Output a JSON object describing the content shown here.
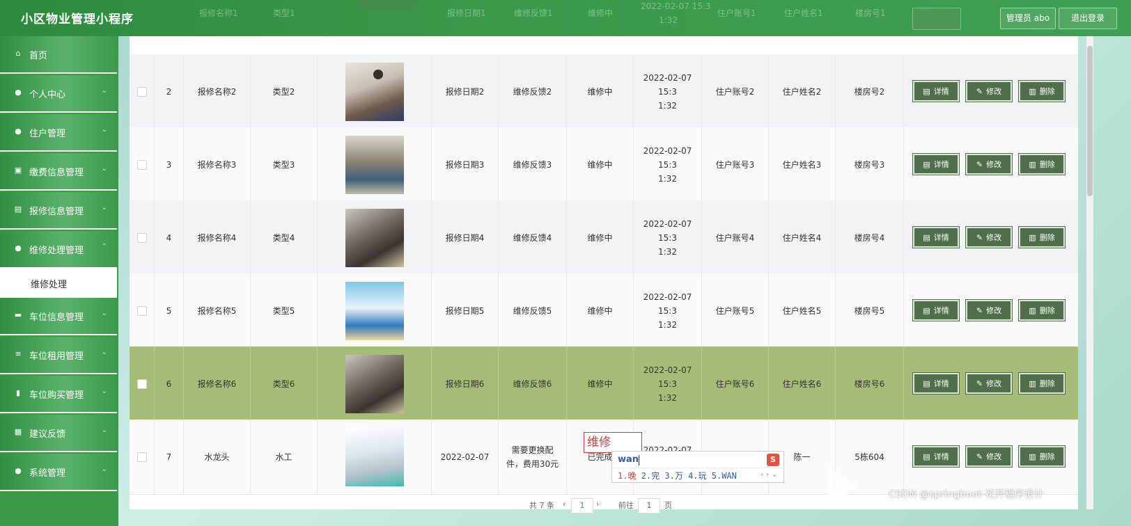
{
  "app": {
    "title": "小区物业管理小程序"
  },
  "header": {
    "admin_label": "管理员 abo",
    "logout_label": "退出登录"
  },
  "sidebar": {
    "items": [
      {
        "label": "首页",
        "icon": "home-icon",
        "glyph": "⌂"
      },
      {
        "label": "个人中心",
        "icon": "user-icon",
        "glyph": "●"
      },
      {
        "label": "住户管理",
        "icon": "location-pin-icon",
        "glyph": "●"
      },
      {
        "label": "缴费信息管理",
        "icon": "clipboard-icon",
        "glyph": "▣"
      },
      {
        "label": "报修信息管理",
        "icon": "document-icon",
        "glyph": "▤"
      },
      {
        "label": "维修处理管理",
        "icon": "user-icon",
        "glyph": "●"
      },
      {
        "label": "车位信息管理",
        "icon": "monitor-icon",
        "glyph": "▬"
      },
      {
        "label": "车位租用管理",
        "icon": "sliders-icon",
        "glyph": "≡"
      },
      {
        "label": "车位购买管理",
        "icon": "bar-chart-icon",
        "glyph": "▮"
      },
      {
        "label": "建议反馈",
        "icon": "grid-icon",
        "glyph": "▦"
      },
      {
        "label": "系统管理",
        "icon": "person-icon",
        "glyph": "●"
      }
    ],
    "sub_item": {
      "label": "维修处理"
    }
  },
  "top_faded_row": {
    "cols": [
      "报修名称1",
      "类型1",
      "报修日期1",
      "维修反馈1",
      "维修中",
      "2022-02-07 15:3",
      "1:32",
      "住户账号1",
      "住户姓名1",
      "楼房号1"
    ],
    "detail": "详情"
  },
  "buttons": {
    "detail": "详情",
    "edit": "修改",
    "delete": "删除"
  },
  "rows": [
    {
      "idx": "2",
      "name": "报修名称2",
      "type": "类型2",
      "date": "报修日期2",
      "feedback": "维修反馈2",
      "status": "维修中",
      "time1": "2022-02-07 15:3",
      "time2": "1:32",
      "account": "住户账号2",
      "owner": "住户姓名2",
      "room": "楼房号2"
    },
    {
      "idx": "3",
      "name": "报修名称3",
      "type": "类型3",
      "date": "报修日期3",
      "feedback": "维修反馈3",
      "status": "维修中",
      "time1": "2022-02-07 15:3",
      "time2": "1:32",
      "account": "住户账号3",
      "owner": "住户姓名3",
      "room": "楼房号3"
    },
    {
      "idx": "4",
      "name": "报修名称4",
      "type": "类型4",
      "date": "报修日期4",
      "feedback": "维修反馈4",
      "status": "维修中",
      "time1": "2022-02-07 15:3",
      "time2": "1:32",
      "account": "住户账号4",
      "owner": "住户姓名4",
      "room": "楼房号4"
    },
    {
      "idx": "5",
      "name": "报修名称5",
      "type": "类型5",
      "date": "报修日期5",
      "feedback": "维修反馈5",
      "status": "维修中",
      "time1": "2022-02-07 15:3",
      "time2": "1:32",
      "account": "住户账号5",
      "owner": "住户姓名5",
      "room": "楼房号5"
    },
    {
      "idx": "6",
      "name": "报修名称6",
      "type": "类型6",
      "date": "报修日期6",
      "feedback": "维修反馈6",
      "status": "维修中",
      "time1": "2022-02-07 15:3",
      "time2": "1:32",
      "account": "住户账号6",
      "owner": "住户姓名6",
      "room": "楼房号6"
    },
    {
      "idx": "7",
      "name": "水龙头",
      "type": "水工",
      "date": "2022-02-07",
      "feedback": "需要更换配",
      "feedback2": "件，费用30元",
      "status": "已完成",
      "time1": "2022-02-07 15:4",
      "time2": "",
      "account": "",
      "owner": "陈一",
      "room": "5栋604"
    }
  ],
  "ime": {
    "preedit": "维修",
    "typed": "wan",
    "candidates": [
      "1.晚",
      "2.完",
      "3.万",
      "4.玩",
      "5.WAN"
    ],
    "logo": "S"
  },
  "pager": {
    "total": "共 7 条",
    "current": "1",
    "goto_label": "前往",
    "goto_value": "1",
    "page_unit": "页"
  },
  "watermark": "CSDN @springboot-花开程序设计",
  "colors": {
    "primary": "#3a9a4a",
    "selected_row": "#a6bd78",
    "op_button": "#4f6f4a"
  }
}
